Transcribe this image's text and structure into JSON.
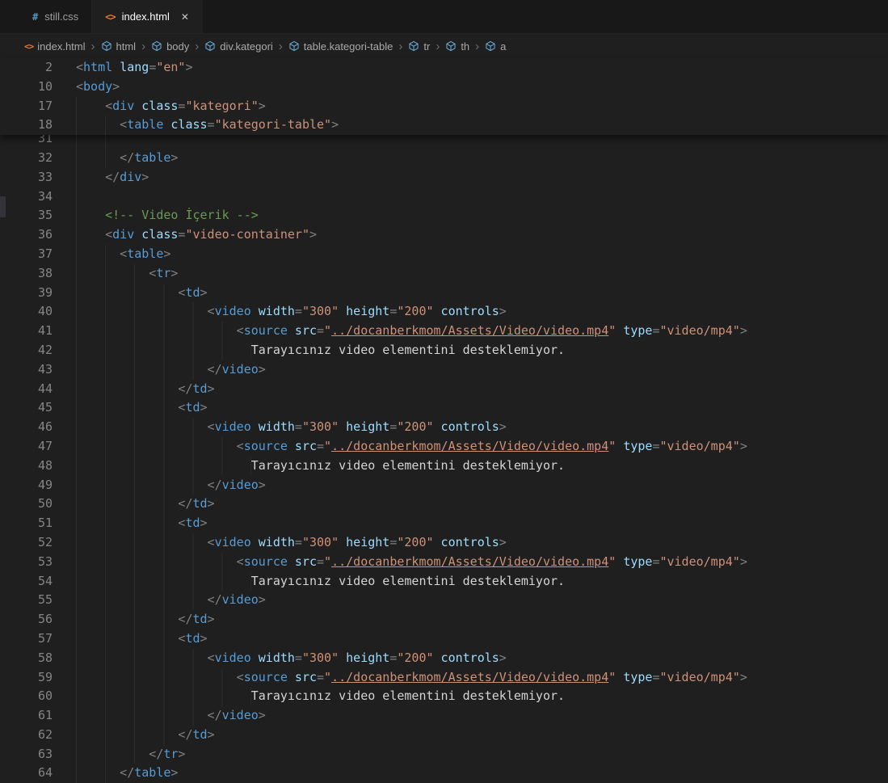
{
  "colors": {
    "editor_bg": "#1f1f1f",
    "tabbar_bg": "#181818",
    "accent_tag": "#569cd6",
    "accent_attr": "#9cdcfe",
    "accent_string": "#ce9178",
    "accent_comment": "#6a9955",
    "accent_punct": "#808080",
    "plain_text": "#d4d4d4",
    "line_number": "#858585",
    "html_icon": "#e37933",
    "css_icon": "#519aba",
    "symbol_icon": "#6fb2e0"
  },
  "icons": {
    "html_glyph": "<>",
    "css_glyph": "#",
    "close_glyph": "✕",
    "cube": "symbol-cube"
  },
  "tabs": [
    {
      "label": "still.css",
      "glyph": "#",
      "active": false
    },
    {
      "label": "index.html",
      "glyph": "<>",
      "active": true,
      "close": "✕"
    }
  ],
  "breadcrumb": {
    "separator": "›",
    "items": [
      {
        "label": "index.html",
        "kind": "file"
      },
      {
        "label": "html",
        "kind": "sym"
      },
      {
        "label": "body",
        "kind": "sym"
      },
      {
        "label": "div.kategori",
        "kind": "sym"
      },
      {
        "label": "table.kategori-table",
        "kind": "sym"
      },
      {
        "label": "tr",
        "kind": "sym"
      },
      {
        "label": "th",
        "kind": "sym"
      },
      {
        "label": "a",
        "kind": "sym"
      }
    ]
  },
  "sticky_lines": [
    {
      "n": "2",
      "i": 0,
      "tok": [
        [
          "p",
          "<"
        ],
        [
          "t",
          "html"
        ],
        [
          "s",
          " "
        ],
        [
          "a",
          "lang"
        ],
        [
          "p",
          "="
        ],
        [
          "v",
          "\"en\""
        ],
        [
          "p",
          ">"
        ]
      ]
    },
    {
      "n": "10",
      "i": 0,
      "tok": [
        [
          "p",
          "<"
        ],
        [
          "t",
          "body"
        ],
        [
          "p",
          ">"
        ]
      ]
    },
    {
      "n": "17",
      "i": 4,
      "tok": [
        [
          "p",
          "<"
        ],
        [
          "t",
          "div"
        ],
        [
          "s",
          " "
        ],
        [
          "a",
          "class"
        ],
        [
          "p",
          "="
        ],
        [
          "v",
          "\"kategori\""
        ],
        [
          "p",
          ">"
        ]
      ]
    },
    {
      "n": "18",
      "i": 6,
      "tok": [
        [
          "p",
          "<"
        ],
        [
          "t",
          "table"
        ],
        [
          "s",
          " "
        ],
        [
          "a",
          "class"
        ],
        [
          "p",
          "="
        ],
        [
          "v",
          "\"kategori-table\""
        ],
        [
          "p",
          ">"
        ]
      ]
    }
  ],
  "code_lines": [
    {
      "n": "31",
      "i": 8,
      "tok": []
    },
    {
      "n": "32",
      "i": 6,
      "tok": [
        [
          "p",
          "</"
        ],
        [
          "t",
          "table"
        ],
        [
          "p",
          ">"
        ]
      ]
    },
    {
      "n": "33",
      "i": 4,
      "tok": [
        [
          "p",
          "</"
        ],
        [
          "t",
          "div"
        ],
        [
          "p",
          ">"
        ]
      ]
    },
    {
      "n": "34",
      "i": 4,
      "tok": []
    },
    {
      "n": "35",
      "i": 4,
      "tok": [
        [
          "c",
          "<!-- Video İçerik -->"
        ]
      ]
    },
    {
      "n": "36",
      "i": 4,
      "tok": [
        [
          "p",
          "<"
        ],
        [
          "t",
          "div"
        ],
        [
          "s",
          " "
        ],
        [
          "a",
          "class"
        ],
        [
          "p",
          "="
        ],
        [
          "v",
          "\"video-container\""
        ],
        [
          "p",
          ">"
        ]
      ]
    },
    {
      "n": "37",
      "i": 6,
      "tok": [
        [
          "p",
          "<"
        ],
        [
          "t",
          "table"
        ],
        [
          "p",
          ">"
        ]
      ]
    },
    {
      "n": "38",
      "i": 10,
      "tok": [
        [
          "p",
          "<"
        ],
        [
          "t",
          "tr"
        ],
        [
          "p",
          ">"
        ]
      ]
    },
    {
      "n": "39",
      "i": 14,
      "tok": [
        [
          "p",
          "<"
        ],
        [
          "t",
          "td"
        ],
        [
          "p",
          ">"
        ]
      ]
    },
    {
      "n": "40",
      "i": 18,
      "tok": [
        [
          "p",
          "<"
        ],
        [
          "t",
          "video"
        ],
        [
          "s",
          " "
        ],
        [
          "a",
          "width"
        ],
        [
          "p",
          "="
        ],
        [
          "v",
          "\"300\""
        ],
        [
          "s",
          " "
        ],
        [
          "a",
          "height"
        ],
        [
          "p",
          "="
        ],
        [
          "v",
          "\"200\""
        ],
        [
          "s",
          " "
        ],
        [
          "a",
          "controls"
        ],
        [
          "p",
          ">"
        ]
      ]
    },
    {
      "n": "41",
      "i": 22,
      "tok": [
        [
          "p",
          "<"
        ],
        [
          "t",
          "source"
        ],
        [
          "s",
          " "
        ],
        [
          "a",
          "src"
        ],
        [
          "p",
          "="
        ],
        [
          "v",
          "\""
        ],
        [
          "l",
          "../docanberkmom/Assets/Video/video.mp4"
        ],
        [
          "v",
          "\""
        ],
        [
          "s",
          " "
        ],
        [
          "a",
          "type"
        ],
        [
          "p",
          "="
        ],
        [
          "v",
          "\"video/mp4\""
        ],
        [
          "p",
          ">"
        ]
      ]
    },
    {
      "n": "42",
      "i": 24,
      "tok": [
        [
          "x",
          "Tarayıcınız video elementini desteklemiyor."
        ]
      ]
    },
    {
      "n": "43",
      "i": 18,
      "tok": [
        [
          "p",
          "</"
        ],
        [
          "t",
          "video"
        ],
        [
          "p",
          ">"
        ]
      ]
    },
    {
      "n": "44",
      "i": 14,
      "tok": [
        [
          "p",
          "</"
        ],
        [
          "t",
          "td"
        ],
        [
          "p",
          ">"
        ]
      ]
    },
    {
      "n": "45",
      "i": 14,
      "tok": [
        [
          "p",
          "<"
        ],
        [
          "t",
          "td"
        ],
        [
          "p",
          ">"
        ]
      ]
    },
    {
      "n": "46",
      "i": 18,
      "tok": [
        [
          "p",
          "<"
        ],
        [
          "t",
          "video"
        ],
        [
          "s",
          " "
        ],
        [
          "a",
          "width"
        ],
        [
          "p",
          "="
        ],
        [
          "v",
          "\"300\""
        ],
        [
          "s",
          " "
        ],
        [
          "a",
          "height"
        ],
        [
          "p",
          "="
        ],
        [
          "v",
          "\"200\""
        ],
        [
          "s",
          " "
        ],
        [
          "a",
          "controls"
        ],
        [
          "p",
          ">"
        ]
      ]
    },
    {
      "n": "47",
      "i": 22,
      "tok": [
        [
          "p",
          "<"
        ],
        [
          "t",
          "source"
        ],
        [
          "s",
          " "
        ],
        [
          "a",
          "src"
        ],
        [
          "p",
          "="
        ],
        [
          "v",
          "\""
        ],
        [
          "l",
          "../docanberkmom/Assets/Video/video.mp4"
        ],
        [
          "v",
          "\""
        ],
        [
          "s",
          " "
        ],
        [
          "a",
          "type"
        ],
        [
          "p",
          "="
        ],
        [
          "v",
          "\"video/mp4\""
        ],
        [
          "p",
          ">"
        ]
      ]
    },
    {
      "n": "48",
      "i": 24,
      "tok": [
        [
          "x",
          "Tarayıcınız video elementini desteklemiyor."
        ]
      ]
    },
    {
      "n": "49",
      "i": 18,
      "tok": [
        [
          "p",
          "</"
        ],
        [
          "t",
          "video"
        ],
        [
          "p",
          ">"
        ]
      ]
    },
    {
      "n": "50",
      "i": 14,
      "tok": [
        [
          "p",
          "</"
        ],
        [
          "t",
          "td"
        ],
        [
          "p",
          ">"
        ]
      ]
    },
    {
      "n": "51",
      "i": 14,
      "tok": [
        [
          "p",
          "<"
        ],
        [
          "t",
          "td"
        ],
        [
          "p",
          ">"
        ]
      ]
    },
    {
      "n": "52",
      "i": 18,
      "tok": [
        [
          "p",
          "<"
        ],
        [
          "t",
          "video"
        ],
        [
          "s",
          " "
        ],
        [
          "a",
          "width"
        ],
        [
          "p",
          "="
        ],
        [
          "v",
          "\"300\""
        ],
        [
          "s",
          " "
        ],
        [
          "a",
          "height"
        ],
        [
          "p",
          "="
        ],
        [
          "v",
          "\"200\""
        ],
        [
          "s",
          " "
        ],
        [
          "a",
          "controls"
        ],
        [
          "p",
          ">"
        ]
      ]
    },
    {
      "n": "53",
      "i": 22,
      "tok": [
        [
          "p",
          "<"
        ],
        [
          "t",
          "source"
        ],
        [
          "s",
          " "
        ],
        [
          "a",
          "src"
        ],
        [
          "p",
          "="
        ],
        [
          "v",
          "\""
        ],
        [
          "l",
          "../docanberkmom/Assets/Video/video.mp4"
        ],
        [
          "v",
          "\""
        ],
        [
          "s",
          " "
        ],
        [
          "a",
          "type"
        ],
        [
          "p",
          "="
        ],
        [
          "v",
          "\"video/mp4\""
        ],
        [
          "p",
          ">"
        ]
      ]
    },
    {
      "n": "54",
      "i": 24,
      "tok": [
        [
          "x",
          "Tarayıcınız video elementini desteklemiyor."
        ]
      ]
    },
    {
      "n": "55",
      "i": 18,
      "tok": [
        [
          "p",
          "</"
        ],
        [
          "t",
          "video"
        ],
        [
          "p",
          ">"
        ]
      ]
    },
    {
      "n": "56",
      "i": 14,
      "tok": [
        [
          "p",
          "</"
        ],
        [
          "t",
          "td"
        ],
        [
          "p",
          ">"
        ]
      ]
    },
    {
      "n": "57",
      "i": 14,
      "tok": [
        [
          "p",
          "<"
        ],
        [
          "t",
          "td"
        ],
        [
          "p",
          ">"
        ]
      ]
    },
    {
      "n": "58",
      "i": 18,
      "tok": [
        [
          "p",
          "<"
        ],
        [
          "t",
          "video"
        ],
        [
          "s",
          " "
        ],
        [
          "a",
          "width"
        ],
        [
          "p",
          "="
        ],
        [
          "v",
          "\"300\""
        ],
        [
          "s",
          " "
        ],
        [
          "a",
          "height"
        ],
        [
          "p",
          "="
        ],
        [
          "v",
          "\"200\""
        ],
        [
          "s",
          " "
        ],
        [
          "a",
          "controls"
        ],
        [
          "p",
          ">"
        ]
      ]
    },
    {
      "n": "59",
      "i": 22,
      "tok": [
        [
          "p",
          "<"
        ],
        [
          "t",
          "source"
        ],
        [
          "s",
          " "
        ],
        [
          "a",
          "src"
        ],
        [
          "p",
          "="
        ],
        [
          "v",
          "\""
        ],
        [
          "l",
          "../docanberkmom/Assets/Video/video.mp4"
        ],
        [
          "v",
          "\""
        ],
        [
          "s",
          " "
        ],
        [
          "a",
          "type"
        ],
        [
          "p",
          "="
        ],
        [
          "v",
          "\"video/mp4\""
        ],
        [
          "p",
          ">"
        ]
      ]
    },
    {
      "n": "60",
      "i": 24,
      "tok": [
        [
          "x",
          "Tarayıcınız video elementini desteklemiyor."
        ]
      ]
    },
    {
      "n": "61",
      "i": 18,
      "tok": [
        [
          "p",
          "</"
        ],
        [
          "t",
          "video"
        ],
        [
          "p",
          ">"
        ]
      ]
    },
    {
      "n": "62",
      "i": 14,
      "tok": [
        [
          "p",
          "</"
        ],
        [
          "t",
          "td"
        ],
        [
          "p",
          ">"
        ]
      ]
    },
    {
      "n": "63",
      "i": 10,
      "tok": [
        [
          "p",
          "</"
        ],
        [
          "t",
          "tr"
        ],
        [
          "p",
          ">"
        ]
      ]
    },
    {
      "n": "64",
      "i": 6,
      "tok": [
        [
          "p",
          "</"
        ],
        [
          "t",
          "table"
        ],
        [
          "p",
          ">"
        ]
      ]
    }
  ]
}
